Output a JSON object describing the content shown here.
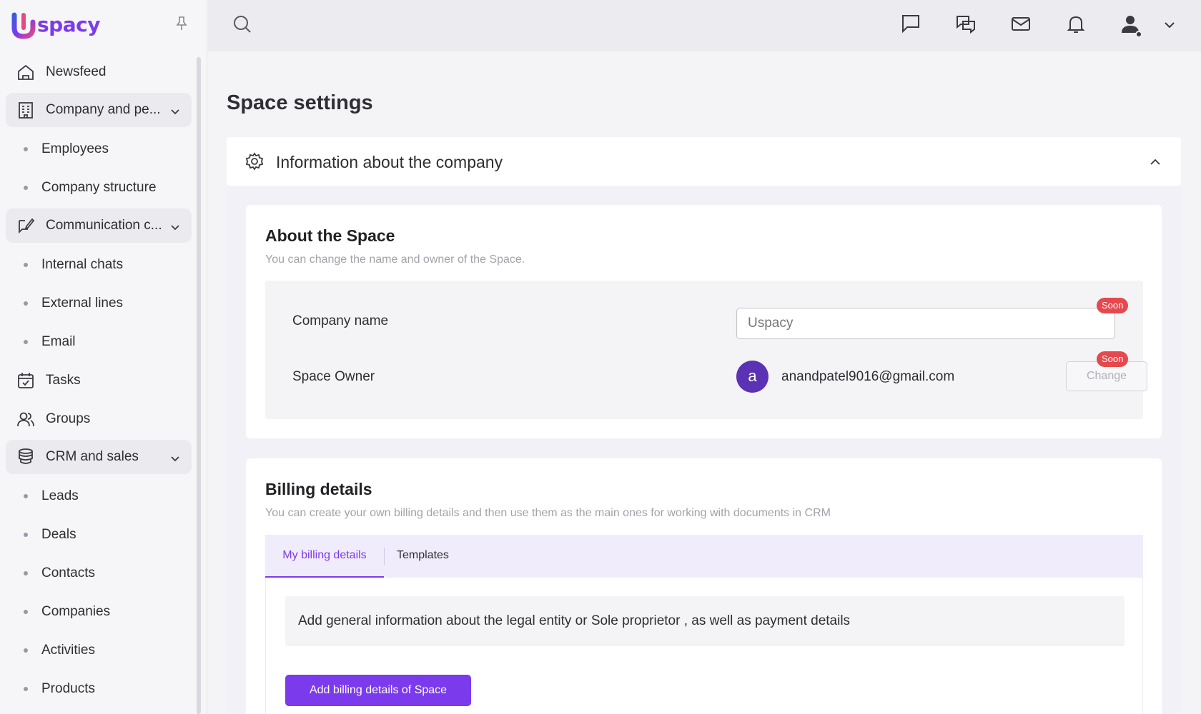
{
  "brand": {
    "name": "spacy",
    "accent": "#7c3aed"
  },
  "sidebar": {
    "items": [
      {
        "label": "Newsfeed",
        "icon": "home-icon"
      },
      {
        "label": "Company and pe...",
        "icon": "building-icon",
        "group": true
      },
      {
        "label": "Employees"
      },
      {
        "label": "Company structure"
      },
      {
        "label": "Communication c...",
        "icon": "chat-edit-icon",
        "group": true
      },
      {
        "label": "Internal chats"
      },
      {
        "label": "External lines"
      },
      {
        "label": "Email"
      },
      {
        "label": "Tasks",
        "icon": "calendar-icon"
      },
      {
        "label": "Groups",
        "icon": "users-icon"
      },
      {
        "label": "CRM and sales",
        "icon": "database-icon",
        "group": true
      },
      {
        "label": "Leads"
      },
      {
        "label": "Deals"
      },
      {
        "label": "Contacts"
      },
      {
        "label": "Companies"
      },
      {
        "label": "Activities"
      },
      {
        "label": "Products"
      }
    ]
  },
  "topbar": {
    "icons": [
      "search-icon",
      "chat-icon",
      "chats-icon",
      "mail-icon",
      "bell-icon",
      "user-icon",
      "chevron-down-icon"
    ]
  },
  "page": {
    "title": "Space settings"
  },
  "section": {
    "title": "Information about the company"
  },
  "about": {
    "title": "About the Space",
    "subtitle": "You can change the name and owner of the Space.",
    "company_label": "Company name",
    "company_placeholder": "Uspacy",
    "owner_label": "Space Owner",
    "owner_initial": "a",
    "owner_email": "anandpatel9016@gmail.com",
    "change_label": "Change",
    "soon_label": "Soon"
  },
  "billing": {
    "title": "Billing details",
    "subtitle": "You can create your own billing details and then use them as the main ones for working with documents in CRM",
    "tabs": [
      {
        "label": "My billing details",
        "active": true
      },
      {
        "label": "Templates",
        "active": false
      }
    ],
    "hint": "Add general information about the legal entity or Sole proprietor , as well as payment details",
    "add_button": "Add billing details of Space"
  }
}
